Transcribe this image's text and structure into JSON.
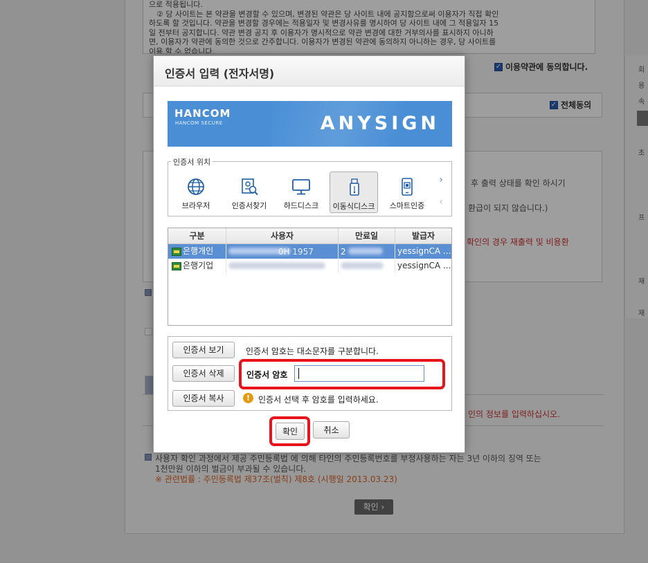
{
  "background": {
    "terms_lines": [
      "으로 적용됩니다.",
      "　② 당 사이트는 본 약관을 변경할 수 있으며, 변경된 약관은 당 사이트 내에 공지함으로써 이용자가 직접 확인",
      "하도록 할 것입니다. 약관을 변경할 경우에는 적용일자 및 변경사유를 명시하여 당 사이트 내에 그 적용일자 15",
      "일 전부터 공지합니다. 약관 변경 공지 후 이용자가 명시적으로 약관 변경에 대한 거부의사를 표시하지 아니하",
      "면, 이용자가 약관에 동의한 것으로 간주합니다. 이용자가 변경된 약관에 동의하지 아니하는 경우, 당 사이트를",
      "이용 할 수 없습니다."
    ],
    "agree_terms_label": "이용약관에 동의합니다.",
    "agree_all_label": "전체동의",
    "check_mark": "✓",
    "line1": "후 출력 상태를 확인 하시기",
    "line2": "환급이 되지 않습니다.)",
    "line3": "확인의 경우 재출력 및 비용환",
    "line4": "인의 정보를 입력하십시오.",
    "notice1": "사용자 확인 과정에서 제공 주민등록법 에 의해 타인의 주민등록번호를 부정사용하는 자는 3년 이하의 징역 또는",
    "notice2": "1천만원 이하의 벌금이 부과될 수 있습니다.",
    "notice3": "※ 관련법률 : 주민등록법 제37조(벌칙) 제8호 (시행일 2013.03.23)",
    "confirm_label": "확인 ›",
    "side_labels": [
      "회",
      "용",
      "속",
      "초",
      "프",
      "재",
      "재"
    ]
  },
  "dialog": {
    "title": "인증서 입력 (전자서명)",
    "brand": {
      "main": "HANCOM",
      "sub": "HANCOM SECURE",
      "product": "ANYSIGN"
    },
    "location": {
      "legend": "인증서 위치",
      "items": [
        {
          "label": "브라우저",
          "icon": "globe-icon"
        },
        {
          "label": "인증서찾기",
          "icon": "certificate-search-icon"
        },
        {
          "label": "하드디스크",
          "icon": "monitor-icon"
        },
        {
          "label": "이동식디스크",
          "icon": "usb-drive-icon"
        },
        {
          "label": "스마트인증",
          "icon": "smartphone-icon"
        }
      ],
      "selected_index": 3,
      "next_arrow": "›",
      "prev_arrow": "‹"
    },
    "table": {
      "headers": [
        "구분",
        "사용자",
        "만료일",
        "발급자"
      ],
      "rows": [
        {
          "type": "은행개인",
          "user": "0H 1957",
          "expiry": "2",
          "issuer": "yessignCA ..."
        },
        {
          "type": "은행기업",
          "user": "",
          "expiry": "",
          "issuer": "yessignCA ..."
        }
      ]
    },
    "actions": {
      "view_label": "인증서 보기",
      "delete_label": "인증서 삭제",
      "copy_label": "인증서 복사",
      "case_hint": "인증서 암호는 대소문자를 구분합니다.",
      "password_label": "인증서 암호",
      "password_value": "",
      "warning_icon": "!",
      "warning_text": "인증서 선택 후 암호를 입력하세요."
    },
    "ok_label": "확인",
    "cancel_label": "취소"
  },
  "colors": {
    "banner": "#4a8fd6",
    "highlight_red": "#e8141c",
    "selected_row": "#5b8fd3"
  }
}
